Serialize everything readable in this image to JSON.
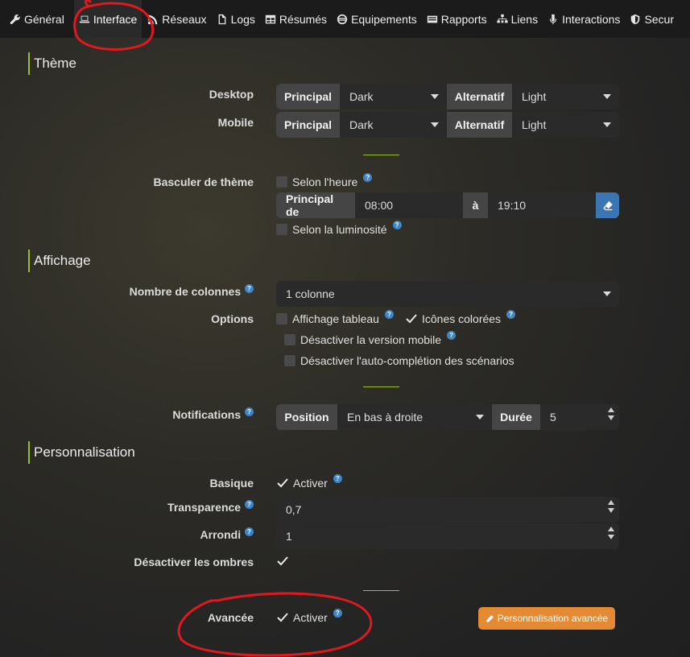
{
  "tabs": [
    {
      "icon": "wrench-icon",
      "label": "Général"
    },
    {
      "icon": "laptop-icon",
      "label": "Interface"
    },
    {
      "icon": "rss-icon",
      "label": "Réseaux"
    },
    {
      "icon": "file-icon",
      "label": "Logs"
    },
    {
      "icon": "table-icon",
      "label": "Résumés"
    },
    {
      "icon": "equipment-icon",
      "label": "Equipements"
    },
    {
      "icon": "report-icon",
      "label": "Rapports"
    },
    {
      "icon": "sitemap-icon",
      "label": "Liens"
    },
    {
      "icon": "microphone-icon",
      "label": "Interactions"
    },
    {
      "icon": "shield-icon",
      "label": "Secur"
    }
  ],
  "theme": {
    "legend": "Thème",
    "desktop_label": "Desktop",
    "mobile_label": "Mobile",
    "principal_label": "Principal",
    "alternatif_label": "Alternatif",
    "desktop_principal": "Dark",
    "desktop_alternatif": "Light",
    "mobile_principal": "Dark",
    "mobile_alternatif": "Light",
    "switch_label": "Basculer de thème",
    "by_time_label": "Selon l'heure",
    "principal_de_label": "Principal de",
    "from_time": "08:00",
    "to_label": "à",
    "to_time": "19:10",
    "by_luminosity_label": "Selon la luminosité"
  },
  "affichage": {
    "legend": "Affichage",
    "columns_label": "Nombre de colonnes",
    "columns_value": "1 colonne",
    "options_label": "Options",
    "table_view_label": "Affichage tableau",
    "colored_icons_label": "Icônes colorées",
    "disable_mobile_label": "Désactiver la version mobile",
    "disable_autocomplete_label": "Désactiver l'auto-complétion des scénarios",
    "notifications_label": "Notifications",
    "position_label": "Position",
    "position_value": "En bas à droite",
    "duration_label": "Durée",
    "duration_value": "5"
  },
  "personnalisation": {
    "legend": "Personnalisation",
    "basic_label": "Basique",
    "enable_label": "Activer",
    "transparency_label": "Transparence",
    "transparency_value": "0,7",
    "rounding_label": "Arrondi",
    "rounding_value": "1",
    "shadows_label": "Désactiver les ombres",
    "advanced_label": "Avancée",
    "advanced_enable_label": "Activer",
    "advanced_button_label": "Personnalisation avancée"
  },
  "colors": {
    "accent": "#97bd34",
    "help": "#3f86c9",
    "orange": "#e38a33",
    "annotation": "#e0191f"
  }
}
